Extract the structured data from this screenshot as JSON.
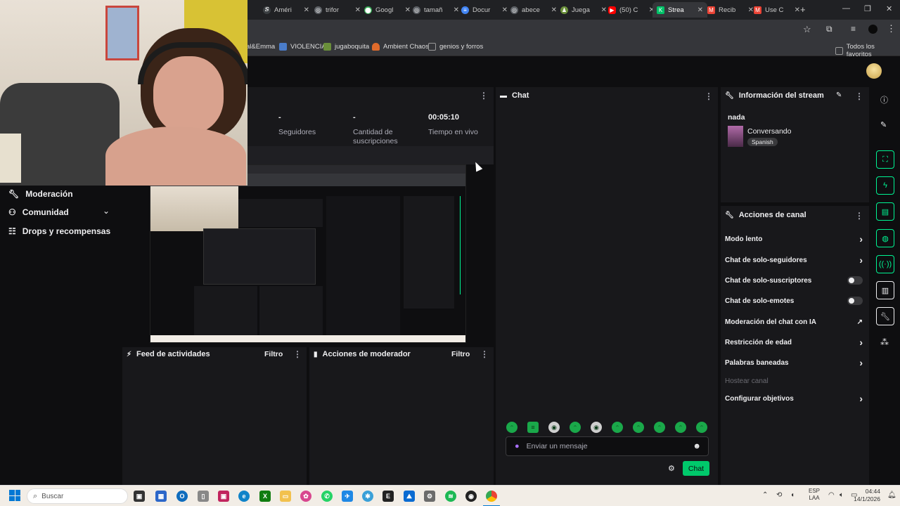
{
  "browser": {
    "tabs": [
      {
        "label": "Améri",
        "icon": "link-icon",
        "color": "#3c4043"
      },
      {
        "label": "trifor",
        "icon": "globe-icon",
        "color": "#5f6368"
      },
      {
        "label": "Googl",
        "icon": "maps-icon",
        "color": "#34a853"
      },
      {
        "label": "tamañ",
        "icon": "globe-icon",
        "color": "#5f6368"
      },
      {
        "label": "Docur",
        "icon": "docs-icon",
        "color": "#4285f4"
      },
      {
        "label": "abece",
        "icon": "globe-icon",
        "color": "#5f6368"
      },
      {
        "label": "Juega",
        "icon": "person-icon",
        "color": "#6a8f3a"
      },
      {
        "label": "(50) C",
        "icon": "youtube-icon",
        "color": "#ff0000"
      },
      {
        "label": "Strea",
        "icon": "twitch-icon",
        "color": "#00c268",
        "active": true
      },
      {
        "label": "Recib",
        "icon": "gmail-icon",
        "color": "#ea4335"
      },
      {
        "label": "Use C",
        "icon": "gmail-icon",
        "color": "#ea4335"
      }
    ],
    "new_tab": "+",
    "bookmarks": [
      {
        "label": "al&Emma"
      },
      {
        "label": "VIOLENCIA",
        "color": "#4a7cc9"
      },
      {
        "label": "jugaboquita",
        "color": "#6a8f3a"
      },
      {
        "label": "Ambient Chaos",
        "color": "#e06b2b"
      },
      {
        "label": "genios y forros",
        "color": "#888888"
      }
    ],
    "all_bookmarks": "Todos los favoritos"
  },
  "stats": {
    "items": [
      {
        "value": "-",
        "label": "Seguidores"
      },
      {
        "value": "-",
        "label": "Cantidad de suscripciones"
      },
      {
        "value": "00:05:10",
        "label": "Tiempo en vivo"
      }
    ]
  },
  "sidebar": {
    "items": [
      {
        "label": "Moderación",
        "icon": "wrench-icon"
      },
      {
        "label": "Comunidad",
        "icon": "people-icon"
      },
      {
        "label": "Drops y recompensas",
        "icon": "gift-icon"
      }
    ]
  },
  "activity_feed": {
    "title": "Feed de actividades",
    "filter": "Filtro"
  },
  "mod_actions": {
    "title": "Acciones de moderador",
    "filter": "Filtro"
  },
  "chat": {
    "title": "Chat",
    "placeholder": "Enviar un mensaje",
    "send_label": "Chat"
  },
  "stream_info": {
    "title": "Información del stream",
    "stream_title": "nada",
    "category": "Conversando",
    "language": "Spanish"
  },
  "channel_actions": {
    "title": "Acciones de canal",
    "items": [
      {
        "label": "Modo lento",
        "control": "chevron"
      },
      {
        "label": "Chat de solo-seguidores",
        "control": "chevron"
      },
      {
        "label": "Chat de solo-suscriptores",
        "control": "toggle"
      },
      {
        "label": "Chat de solo-emotes",
        "control": "toggle"
      },
      {
        "label": "Moderación del chat con IA",
        "control": "external"
      },
      {
        "label": "Restricción de edad",
        "control": "chevron"
      },
      {
        "label": "Palabras baneadas",
        "control": "chevron"
      },
      {
        "label": "Hostear canal",
        "control": "none",
        "disabled": true
      },
      {
        "label": "Configurar objetivos",
        "control": "chevron"
      }
    ]
  },
  "taskbar": {
    "search_placeholder": "Buscar",
    "lang_top": "ESP",
    "lang_bottom": "LAA",
    "time": "04:44",
    "date": "14/1/2026"
  },
  "colors": {
    "accent": "#00f593",
    "send": "#00c96b",
    "bg": "#0e0e10",
    "panel": "#18181b"
  }
}
